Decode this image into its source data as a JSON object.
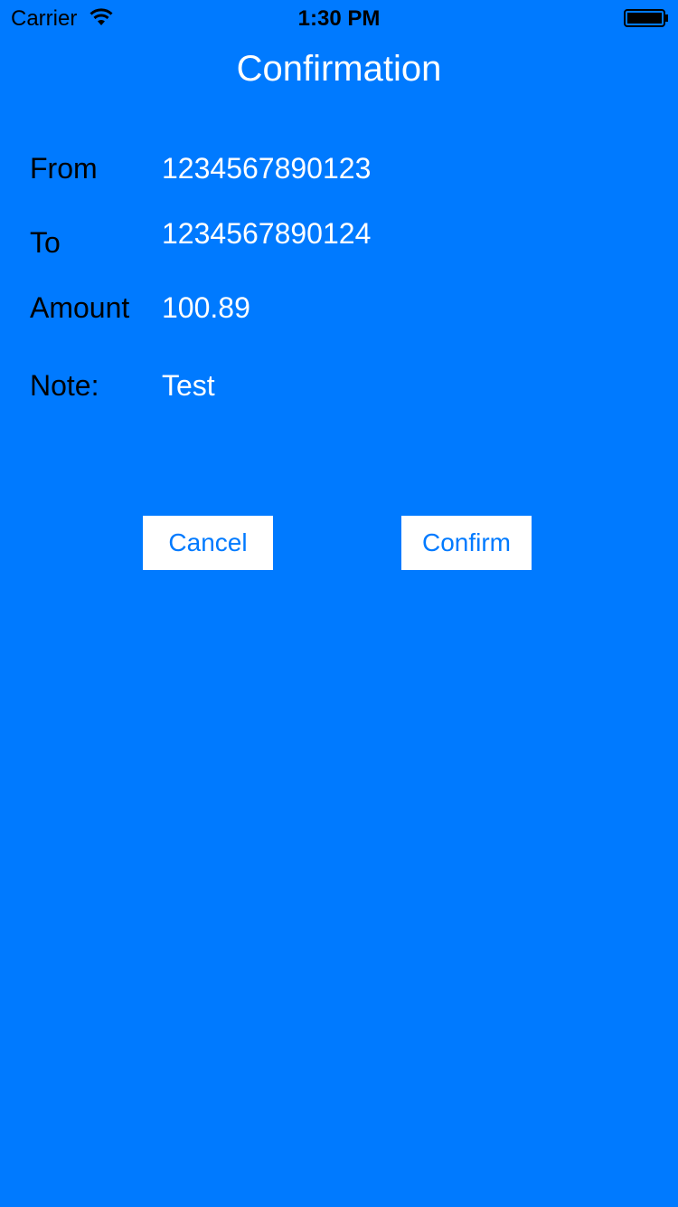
{
  "status_bar": {
    "carrier": "Carrier",
    "time": "1:30 PM",
    "wifi_icon": "wifi-icon",
    "battery_icon": "battery-icon"
  },
  "page": {
    "title": "Confirmation",
    "background_color": "#007AFF"
  },
  "fields": {
    "from_label": "From",
    "from_value": "1234567890123",
    "to_label": "To",
    "to_value": "1234567890124",
    "amount_label": "Amount",
    "amount_value": "100.89",
    "note_label": "Note:",
    "note_value": "Test"
  },
  "actions": {
    "cancel_label": "Cancel",
    "confirm_label": "Confirm"
  }
}
